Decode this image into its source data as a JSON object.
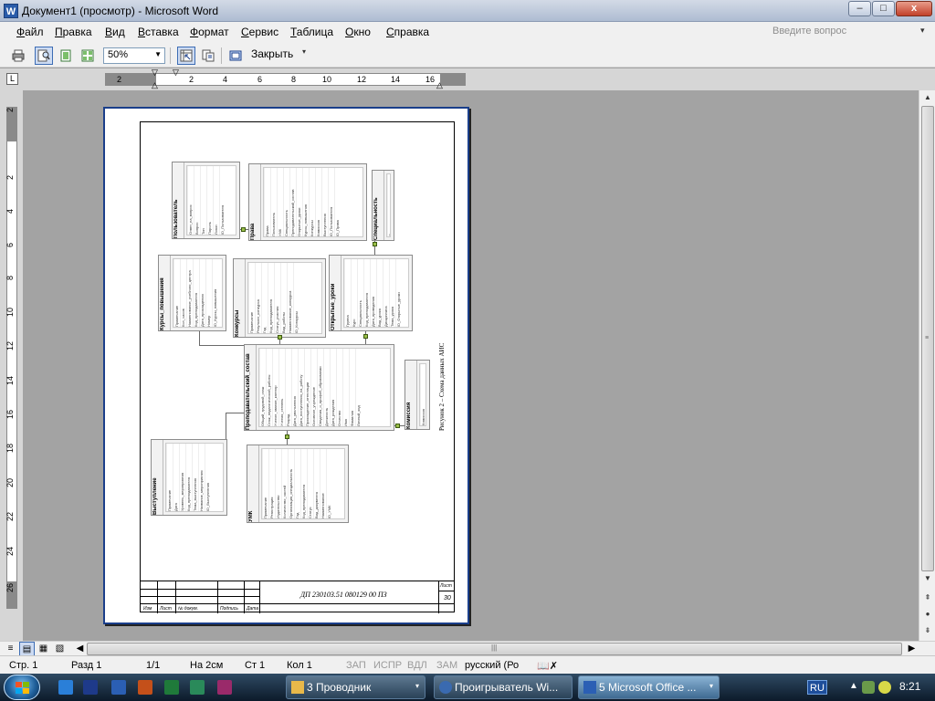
{
  "window": {
    "title": "Документ1 (просмотр) - Microsoft Word",
    "app_icon_letter": "W",
    "minimize": "–",
    "maximize": "□",
    "close": "x"
  },
  "menu": {
    "items": [
      {
        "label": "Файл",
        "key": "Ф",
        "rest": "айл"
      },
      {
        "label": "Правка",
        "key": "П",
        "rest": "равка"
      },
      {
        "label": "Вид",
        "key": "В",
        "rest": "ид"
      },
      {
        "label": "Вставка",
        "key": "В",
        "rest": "ставка"
      },
      {
        "label": "Формат",
        "key": "Ф",
        "rest": "ормат"
      },
      {
        "label": "Сервис",
        "key": "С",
        "rest": "ервис"
      },
      {
        "label": "Таблица",
        "key": "Т",
        "rest": "аблица"
      },
      {
        "label": "Окно",
        "key": "О",
        "rest": "кно"
      },
      {
        "label": "Справка",
        "key": "С",
        "rest": "правка"
      }
    ],
    "help_placeholder": "Введите вопрос"
  },
  "toolbar": {
    "zoom": "50%",
    "close_label": "Закрыть"
  },
  "ruler": {
    "h_ticks": [
      "2",
      "2",
      "4",
      "6",
      "8",
      "10",
      "12",
      "14",
      "16"
    ],
    "v_ticks": [
      "2",
      "2",
      "4",
      "6",
      "8",
      "10",
      "12",
      "14",
      "16",
      "18",
      "20",
      "22",
      "24",
      "26"
    ]
  },
  "diagram": {
    "caption": "Рисунок 2 – Схема данных АИС",
    "tables": [
      {
        "name": "Пользователь",
        "fields": [
          "ID_Пользователя",
          "Логин",
          "Пароль",
          "Тип",
          "Вопрос",
          "Ответ_на_вопрос"
        ]
      },
      {
        "name": "Права",
        "fields": [
          "ID_Права",
          "ID_Пользователя",
          "Выступления",
          "Комиссия",
          "Конкурсы",
          "Курсы_повышения",
          "Открытые_уроки",
          "Преподавательский_состав",
          "Специальность",
          "УМК",
          "Пользователь",
          "Права"
        ]
      },
      {
        "name": "Специальность",
        "fields": [
          "Специальность"
        ]
      },
      {
        "name": "Курсы_повышения",
        "fields": [
          "ID_Курсы_повышения",
          "Номер",
          "Дата_прохождения",
          "Код_преподавателя",
          "Наименование_учебного_центра",
          "Кол_часов",
          "Примечание"
        ]
      },
      {
        "name": "Конкурсы",
        "fields": [
          "ID_Конкурсы",
          "Наименование_конкурса",
          "Вид_работы",
          "Статус_участия",
          "Код_преподавателя",
          "Год",
          "Результат_конкурса",
          "Примечание"
        ]
      },
      {
        "name": "Открытые_уроки",
        "fields": [
          "ID_Открытые_уроки",
          "Тема_урока",
          "Дисциплина",
          "Вид_урока",
          "Дата_проведения",
          "Код_преподавателя",
          "Специальность",
          "Курс",
          "Группа"
        ]
      },
      {
        "name": "Преподавательский_состав",
        "fields": [
          "Личный_код",
          "Фамилия",
          "Имя",
          "Отчество",
          "Дата_рождения",
          "Должность",
          "Сведения_о_профоб_образовании",
          "Основное_учреждение",
          "Прохождение_аттестации",
          "Дата_поступления_на_работу",
          "Дата_увольнения",
          "Разряд",
          "Ученая_степень",
          "Ученое_звание_категор",
          "Стаж_педагогической_работы",
          "Общий_трудовой_стаж"
        ]
      },
      {
        "name": "Комиссия",
        "fields": [
          "Комиссия"
        ]
      },
      {
        "name": "Выступление",
        "fields": [
          "ID_Выступления",
          "Название_мероприятия",
          "Тема_выступления",
          "Код_преподавателя",
          "Уровень_мероприятия",
          "Дата",
          "Примечание"
        ]
      },
      {
        "name": "УМК",
        "fields": [
          "ID_УМК",
          "Наименование",
          "Вид_документа",
          "Статус",
          "Код_преподавателя",
          "Год",
          "Организация_специальность",
          "Количество_частей",
          "Издательство",
          "Регистрация",
          "Примечание"
        ]
      }
    ]
  },
  "stamp": {
    "doc_code": "ДП 230103.51 080129 00 ПЗ",
    "sheet_label": "Лист",
    "sheet_number": "30",
    "columns": [
      "Изм",
      "Лист",
      "№ докум.",
      "Подпись",
      "Дата"
    ]
  },
  "status": {
    "page": "Стр. 1",
    "section": "Разд 1",
    "pages": "1/1",
    "at": "На 2см",
    "line": "Ст 1",
    "col": "Кол 1",
    "rec": "ЗАП",
    "trk": "ИСПР",
    "ext": "ВДЛ",
    "ovr": "ЗАМ",
    "language": "русский (Ро"
  },
  "taskbar": {
    "tasks": [
      {
        "label": "3 Проводник"
      },
      {
        "label": "Проигрыватель Wi..."
      },
      {
        "label": "5 Microsoft Office ..."
      }
    ],
    "lang": "RU",
    "clock": "8:21"
  },
  "colors": {
    "accent": "#1a3e8a",
    "connector_knob": "#9bc04a"
  }
}
